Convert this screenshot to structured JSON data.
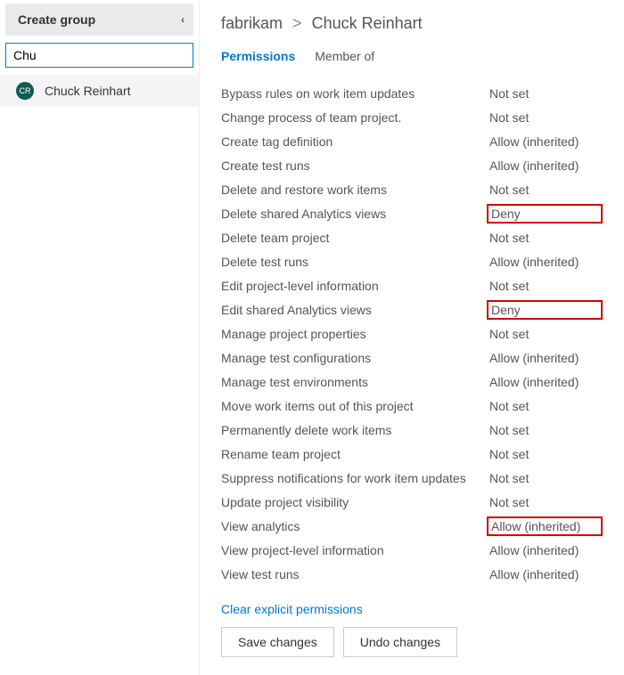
{
  "sidebar": {
    "create_group_label": "Create group",
    "search_value": "Chu",
    "user": {
      "initials": "CR",
      "name": "Chuck Reinhart"
    }
  },
  "breadcrumb": {
    "org": "fabrikam",
    "sep": ">",
    "user": "Chuck Reinhart"
  },
  "tabs": {
    "permissions": "Permissions",
    "member_of": "Member of"
  },
  "permissions": [
    {
      "label": "Bypass rules on work item updates",
      "value": "Not set",
      "hl": false
    },
    {
      "label": "Change process of team project.",
      "value": "Not set",
      "hl": false
    },
    {
      "label": "Create tag definition",
      "value": "Allow (inherited)",
      "hl": false
    },
    {
      "label": "Create test runs",
      "value": "Allow (inherited)",
      "hl": false
    },
    {
      "label": "Delete and restore work items",
      "value": "Not set",
      "hl": false
    },
    {
      "label": "Delete shared Analytics views",
      "value": "Deny",
      "hl": true
    },
    {
      "label": "Delete team project",
      "value": "Not set",
      "hl": false
    },
    {
      "label": "Delete test runs",
      "value": "Allow (inherited)",
      "hl": false
    },
    {
      "label": "Edit project-level information",
      "value": "Not set",
      "hl": false
    },
    {
      "label": "Edit shared Analytics views",
      "value": "Deny",
      "hl": true
    },
    {
      "label": "Manage project properties",
      "value": "Not set",
      "hl": false
    },
    {
      "label": "Manage test configurations",
      "value": "Allow (inherited)",
      "hl": false
    },
    {
      "label": "Manage test environments",
      "value": "Allow (inherited)",
      "hl": false
    },
    {
      "label": "Move work items out of this project",
      "value": "Not set",
      "hl": false
    },
    {
      "label": "Permanently delete work items",
      "value": "Not set",
      "hl": false
    },
    {
      "label": "Rename team project",
      "value": "Not set",
      "hl": false
    },
    {
      "label": "Suppress notifications for work item updates",
      "value": "Not set",
      "hl": false
    },
    {
      "label": "Update project visibility",
      "value": "Not set",
      "hl": false
    },
    {
      "label": "View analytics",
      "value": "Allow (inherited)",
      "hl": true
    },
    {
      "label": "View project-level information",
      "value": "Allow (inherited)",
      "hl": false
    },
    {
      "label": "View test runs",
      "value": "Allow (inherited)",
      "hl": false
    }
  ],
  "actions": {
    "clear": "Clear explicit permissions",
    "save": "Save changes",
    "undo": "Undo changes"
  }
}
